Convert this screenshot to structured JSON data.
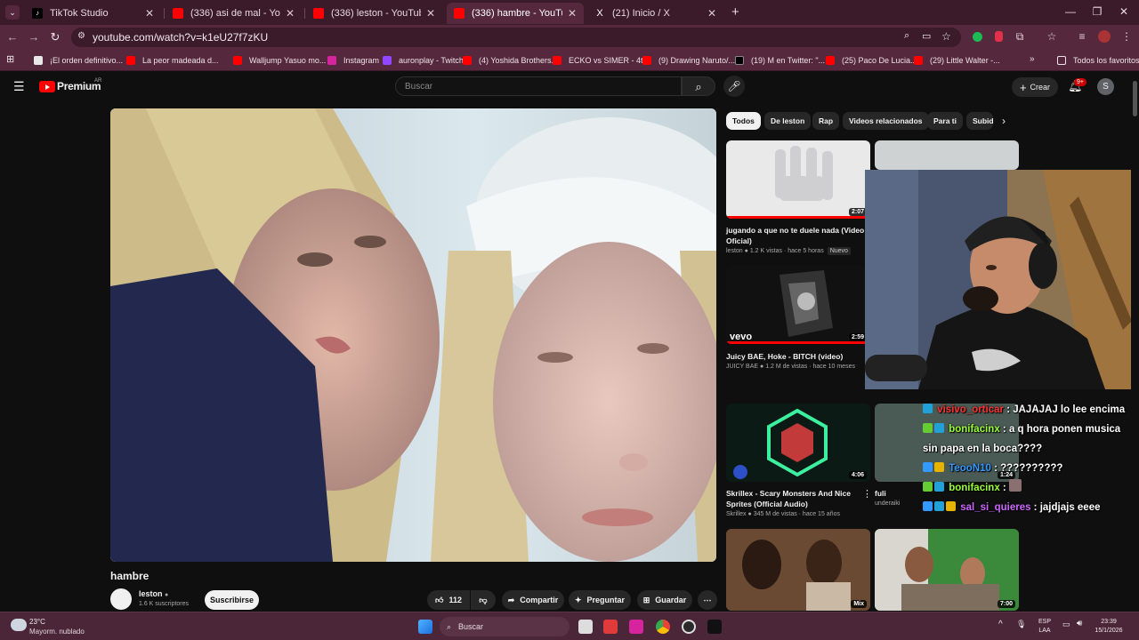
{
  "browser": {
    "tabs": [
      {
        "title": "TikTok Studio",
        "favicon": "tiktok-icon",
        "color": "#000000",
        "active": false
      },
      {
        "title": "(336) asi de mal - YouTube",
        "favicon": "youtube-icon",
        "color": "#ff0000",
        "active": false
      },
      {
        "title": "(336) leston - YouTube",
        "favicon": "youtube-icon",
        "color": "#ff0000",
        "active": false
      },
      {
        "title": "(336) hambre - YouTube",
        "favicon": "youtube-icon",
        "color": "#ff0000",
        "active": true
      },
      {
        "title": "(21) Inicio / X",
        "favicon": "x-icon",
        "color": "#000000",
        "active": false
      }
    ],
    "url": "youtube.com/watch?v=k1eU27f7zKU",
    "bookmarks": [
      {
        "label": "¡El orden definitivo...",
        "icon": "page-icon",
        "color": "#e8e8e8"
      },
      {
        "label": "La peor madeada d...",
        "icon": "youtube-icon",
        "color": "#ff0000"
      },
      {
        "label": "Walljump Yasuo mo...",
        "icon": "youtube-icon",
        "color": "#ff0000"
      },
      {
        "label": "Instagram",
        "icon": "instagram-icon",
        "color": "#d6249f"
      },
      {
        "label": "auronplay - Twitch",
        "icon": "twitch-icon",
        "color": "#9146ff"
      },
      {
        "label": "(4) Yoshida Brothers...",
        "icon": "youtube-icon",
        "color": "#ff0000"
      },
      {
        "label": "ECKO vs SIMER - 4t...",
        "icon": "youtube-icon",
        "color": "#ff0000"
      },
      {
        "label": "(9) Drawing Naruto/...",
        "icon": "youtube-icon",
        "color": "#ff0000"
      },
      {
        "label": "(19) M en Twitter: \"...",
        "icon": "x-icon",
        "color": "#000000"
      },
      {
        "label": "(25) Paco De Lucia...",
        "icon": "youtube-icon",
        "color": "#ff0000"
      },
      {
        "label": "(29) Little Walter -...",
        "icon": "youtube-icon",
        "color": "#ff0000"
      }
    ],
    "all_favorites": "Todos los favoritos"
  },
  "youtube": {
    "logo_text": "Premium",
    "region": "AR",
    "search_placeholder": "Buscar",
    "create_label": "Crear",
    "notif_count": "9+",
    "avatar_letter": "S",
    "video_title": "hambre",
    "channel_name": "leston",
    "channel_subs": "1.6 K suscriptores",
    "subscribe_label": "Suscribirse",
    "likes": "112",
    "share_label": "Compartir",
    "ask_label": "Preguntar",
    "save_label": "Guardar",
    "chips": [
      "Todos",
      "De leston",
      "Rap",
      "Videos relacionados",
      "Para ti",
      "Subid"
    ],
    "recommendations": [
      {
        "title": "jugando a que no te duele nada (Video Oficial)",
        "channel": "leston",
        "meta": "1.2 K vistas · hace 5 horas",
        "badge": "Nuevo",
        "duration": "2:07"
      },
      {
        "title": "Juicy BAE, Hoke - BITCH (video)",
        "channel": "JUICY BAE",
        "meta": "1.2 M de vistas · hace 10 meses",
        "duration": "2:59",
        "brand": "vevo"
      },
      {
        "title": "Skrillex - Scary Monsters And Nice Sprites (Official Audio)",
        "channel": "Skrillex",
        "meta": "345 M de vistas · hace 15 años",
        "duration": "4:06"
      },
      {
        "title": "fuli",
        "channel": "underaiki",
        "meta": "",
        "duration": "1:24"
      },
      {
        "title": "",
        "channel": "",
        "meta": "",
        "duration": "Mix"
      },
      {
        "title": "",
        "channel": "",
        "meta": "",
        "duration": "7:00"
      }
    ]
  },
  "chat": [
    {
      "user": "visivo_orticar",
      "msg": "JAJAJAJ lo lee encima",
      "color": "#ff3333"
    },
    {
      "user": "bonifacinx",
      "msg": "a q hora ponen musica sin papa en la boca????",
      "color": "#99ff33"
    },
    {
      "user": "TeooN10",
      "msg": "??????????",
      "color": "#3399ff"
    },
    {
      "user": "bonifacinx",
      "msg": "",
      "color": "#99ff33"
    },
    {
      "user": "sal_si_quieres",
      "msg": "jajdjajs eeee",
      "color": "#cc66ff"
    }
  ],
  "taskbar": {
    "weather_temp": "23°C",
    "weather_desc": "Mayorm. nublado",
    "search_label": "Buscar",
    "lang": "ESP",
    "lang2": "LAA",
    "time": "23:39",
    "date": "15/1/2026"
  }
}
